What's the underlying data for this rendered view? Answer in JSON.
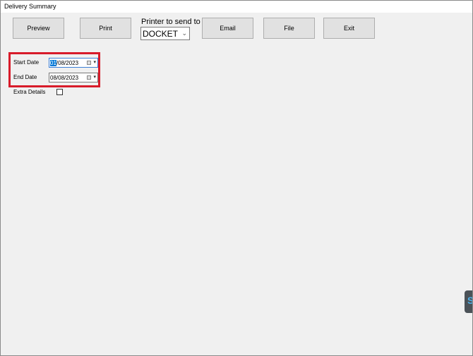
{
  "window": {
    "title": "Delivery Summary"
  },
  "toolbar": {
    "preview_label": "Preview",
    "print_label": "Print",
    "printer_label": "Printer to send to",
    "printer_value": "DOCKET",
    "email_label": "Email",
    "file_label": "File",
    "exit_label": "Exit"
  },
  "filters": {
    "start_date_label": "Start Date",
    "start_date_day": "01",
    "start_date_rest": "/08/2023",
    "end_date_label": "End Date",
    "end_date_value": "08/08/2023",
    "extra_details_label": "Extra Details",
    "extra_details_checked": false
  },
  "icons": {
    "calendar": "calendar-icon",
    "dropdown": "chevron-down-icon"
  },
  "colors": {
    "highlight": "#d81b2a",
    "selection": "#0078d7",
    "background": "#f0f0f0"
  }
}
